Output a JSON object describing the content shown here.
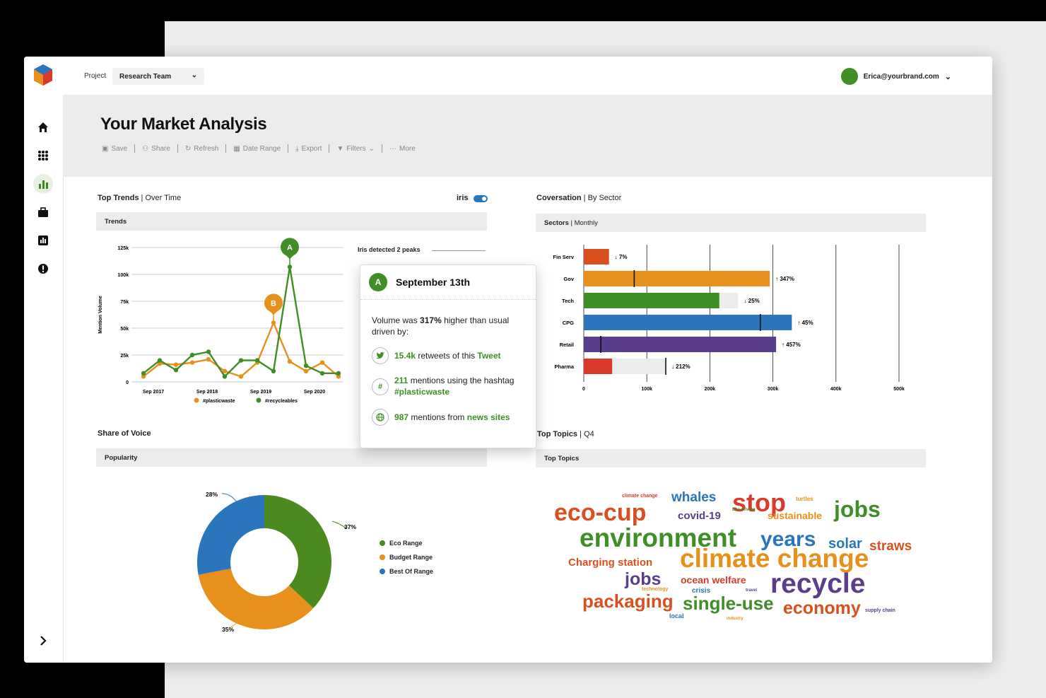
{
  "project": {
    "label": "Project",
    "value": "Research Team"
  },
  "user": {
    "email": "Erica@yourbrand.com"
  },
  "page": {
    "title": "Your Market Analysis"
  },
  "toolbar": [
    "Save",
    "Share",
    "Refresh",
    "Date Range",
    "Export",
    "Filters",
    "More"
  ],
  "trends": {
    "title": "Top Trends",
    "subtitle": "Over Time",
    "toggle_label": "iris",
    "header": "Trends",
    "peaks_note": "Iris detected 2 peaks",
    "ylabel": "Mention Volume",
    "peak_a": "A",
    "peak_b": "B",
    "legend": [
      "#plasticwaste",
      "#recycleables"
    ]
  },
  "popup": {
    "badge": "A",
    "date": "September 13th",
    "line1_a": "Volume was ",
    "line1_b": "317%",
    "line1_c": " higher than usual driven by:",
    "r1_a": "15.4k",
    "r1_b": " retweets of this ",
    "r1_c": "Tweet",
    "r2_a": "211",
    "r2_b": " mentions using the hashtag ",
    "r2_c": "#plasticwaste",
    "r3_a": "987",
    "r3_b": " mentions from ",
    "r3_c": "news sites"
  },
  "sectors": {
    "title": "Coversation",
    "subtitle": "By Sector",
    "header": "Sectors",
    "header_sub": "Monthly"
  },
  "sov": {
    "title": "Share of Voice",
    "header": "Popularity",
    "legend": [
      "Eco Range",
      "Budget Range",
      "Best Of Range"
    ]
  },
  "topics": {
    "title": "Top Topics",
    "subtitle": "Q4",
    "header": "Top Topics"
  },
  "chart_data": [
    {
      "type": "line",
      "title": "Trends",
      "ylabel": "Mention Volume",
      "y_ticks": [
        "0",
        "25k",
        "50k",
        "75k",
        "100k",
        "125k"
      ],
      "ylim": [
        0,
        125000
      ],
      "x_ticks": [
        "Sep 2017",
        "Sep 2018",
        "Sep 2019",
        "Sep 2020"
      ],
      "colors": [
        "#e8901c",
        "#3f8e26"
      ],
      "series": [
        {
          "name": "#plasticwaste",
          "values": [
            5000,
            17000,
            16000,
            18000,
            21000,
            10000,
            5000,
            18000,
            55000,
            19000,
            10000,
            18000,
            5000
          ]
        },
        {
          "name": "#recycleables",
          "values": [
            8000,
            20000,
            11000,
            25000,
            28000,
            5000,
            20000,
            20000,
            10000,
            107000,
            15000,
            8000,
            8000
          ]
        }
      ]
    },
    {
      "type": "bar",
      "title": "Sectors",
      "orientation": "horizontal",
      "categories": [
        "Fin Serv",
        "Gov",
        "Tech",
        "CPG",
        "Retail",
        "Pharma"
      ],
      "values": [
        40000,
        295000,
        215000,
        330000,
        305000,
        45000
      ],
      "ranges": [
        40000,
        295000,
        245000,
        330000,
        305000,
        130000
      ],
      "markers": [
        null,
        80000,
        null,
        280000,
        27000,
        130000
      ],
      "change_labels": [
        "↓ 7%",
        "↑ 347%",
        "↓ 25%",
        "↑ 45%",
        "↑ 457%",
        "↓ 212%"
      ],
      "colors": [
        "#d9501e",
        "#e8901c",
        "#3f8e26",
        "#2a75bb",
        "#5a3d8c",
        "#d93a2a"
      ],
      "x_ticks": [
        "0",
        "100k",
        "200k",
        "300k",
        "400k",
        "500k"
      ],
      "xlim": [
        0,
        500000
      ]
    },
    {
      "type": "pie",
      "title": "Popularity",
      "categories": [
        "Eco Range",
        "Budget Range",
        "Best Of Range"
      ],
      "values": [
        37,
        35,
        28
      ],
      "labels": [
        "37%",
        "35%",
        "28%"
      ],
      "colors": [
        "#4a8a1f",
        "#e8901c",
        "#2a75bb"
      ]
    }
  ],
  "wordcloud": [
    {
      "text": "climate change",
      "color": "#d93a2a"
    },
    {
      "text": "whales",
      "color": "#2a75bb"
    },
    {
      "text": "stop",
      "color": "#d93a2a"
    },
    {
      "text": "turtles",
      "color": "#e8901c"
    },
    {
      "text": "eco-cup",
      "color": "#d9501e"
    },
    {
      "text": "covid-19",
      "color": "#5a3d8c"
    },
    {
      "text": "Eco driving",
      "color": "#3f8e26"
    },
    {
      "text": "sustainable",
      "color": "#e8901c"
    },
    {
      "text": "jobs",
      "color": "#3f8e26"
    },
    {
      "text": "environment",
      "color": "#3f8e26"
    },
    {
      "text": "years",
      "color": "#2a75bb"
    },
    {
      "text": "solar",
      "color": "#2a75bb"
    },
    {
      "text": "straws",
      "color": "#d9501e"
    },
    {
      "text": "Charging station",
      "color": "#d9501e"
    },
    {
      "text": "climate change",
      "color": "#e8901c"
    },
    {
      "text": "jobs",
      "color": "#5a3d8c"
    },
    {
      "text": "ocean welfare",
      "color": "#d93a2a"
    },
    {
      "text": "recycle",
      "color": "#5a3d8c"
    },
    {
      "text": "technology",
      "color": "#e8901c"
    },
    {
      "text": "crisis",
      "color": "#2a75bb"
    },
    {
      "text": "travel",
      "color": "#5a3d8c"
    },
    {
      "text": "packaging",
      "color": "#d9501e"
    },
    {
      "text": "single-use",
      "color": "#3f8e26"
    },
    {
      "text": "economy",
      "color": "#d9501e"
    },
    {
      "text": "supply chain",
      "color": "#5a3d8c"
    },
    {
      "text": "local",
      "color": "#2a75bb"
    },
    {
      "text": "industry",
      "color": "#e8901c"
    }
  ]
}
